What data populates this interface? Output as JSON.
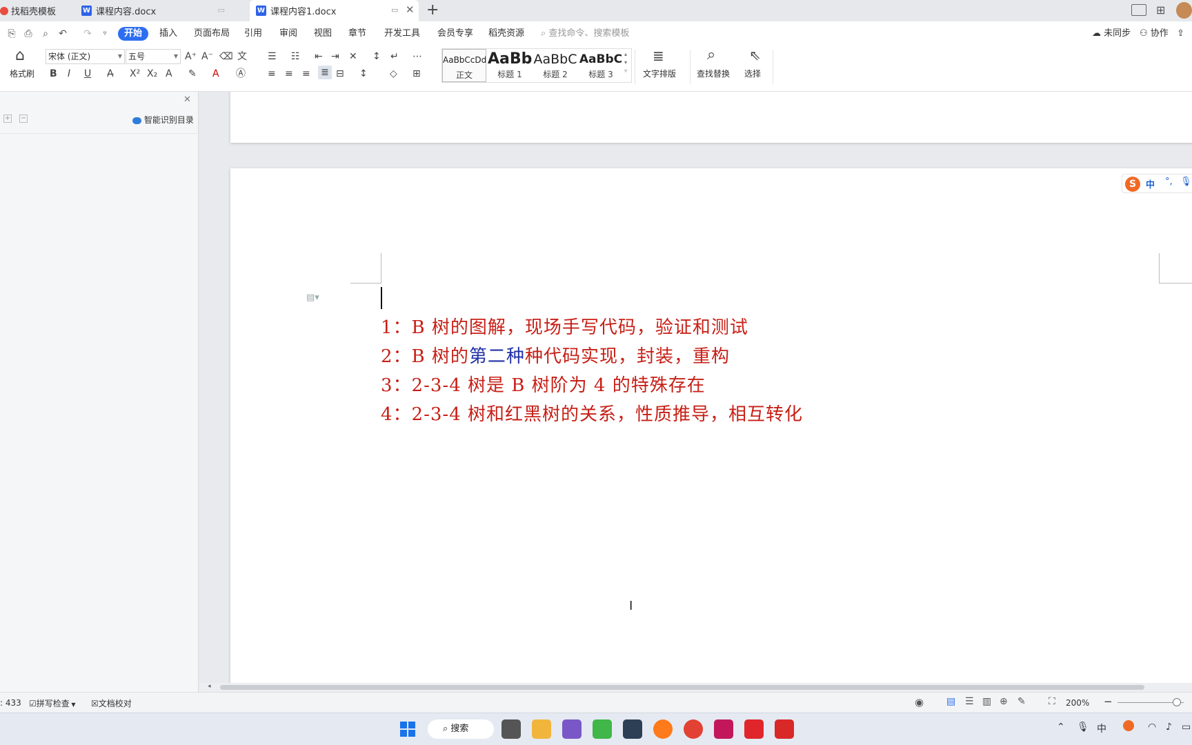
{
  "tabs": [
    {
      "label": "找稻壳模板"
    },
    {
      "label": "课程内容.docx"
    },
    {
      "label": "课程内容1.docx"
    }
  ],
  "menu": {
    "items": [
      "开始",
      "插入",
      "页面布局",
      "引用",
      "审阅",
      "视图",
      "章节",
      "开发工具",
      "会员专享",
      "稻壳资源"
    ],
    "search_placeholder": "查找命令、搜索模板",
    "sync": "未同步",
    "collab": "协作"
  },
  "ribbon": {
    "format_painter": "格式刷",
    "font_name": "宋体 (正文)",
    "font_size": "五号",
    "styles": [
      {
        "preview": "AaBbCcDd",
        "label": "正文"
      },
      {
        "preview": "AaBb",
        "label": "标题 1"
      },
      {
        "preview": "AaBbC",
        "label": "标题 2"
      },
      {
        "preview": "AaBbC",
        "label": "标题 3"
      }
    ],
    "text_layout": "文字排版",
    "find_replace": "查找替换",
    "select": "选择"
  },
  "nav_pane": {
    "smart_toc": "智能识别目录"
  },
  "document": {
    "lines": [
      {
        "num": "1：",
        "text": "B 树的图解，现场手写代码，验证和测试"
      },
      {
        "num": "2：",
        "pre": "B 树的",
        "highlight": "第二种",
        "post": "种代码实现，封装，重构"
      },
      {
        "num": "3：",
        "text": "2-3-4 树是 B 树阶为 4 的特殊存在"
      },
      {
        "num": "4：",
        "text": "2-3-4 树和红黑树的关系，性质推导，相互转化"
      }
    ],
    "ime": "中"
  },
  "status": {
    "word_count": ": 433",
    "spell_check": "拼写检查",
    "doc_proof": "文档校对",
    "zoom": "200%"
  },
  "taskbar": {
    "search": "搜索"
  }
}
